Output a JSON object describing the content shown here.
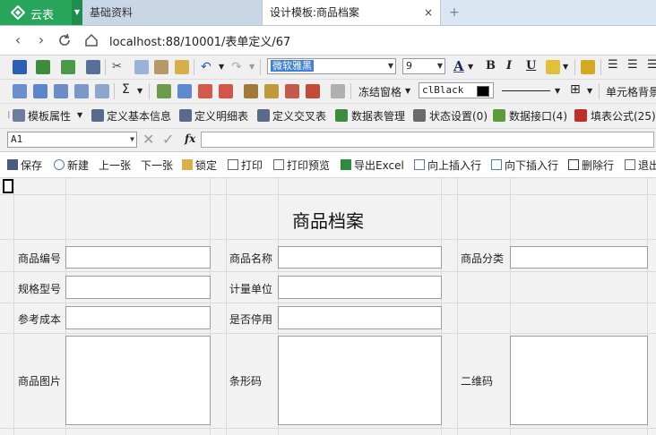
{
  "browser": {
    "app_name": "云表",
    "tabs": [
      {
        "label": "基础资料",
        "active": false
      },
      {
        "label": "设计模板:商品档案",
        "active": true
      }
    ],
    "close_glyph": "×",
    "new_tab_glyph": "+",
    "url": "localhost:88/10001/表单定义/67"
  },
  "format_toolbar": {
    "font_name": "微软雅黑",
    "font_size": "9",
    "text_color_glyph": "A",
    "bold": "B",
    "italic": "I",
    "underline": "U"
  },
  "table_toolbar": {
    "sum_glyph": "Σ",
    "freeze_label": "冻结窗格",
    "color_value": "clBlack",
    "cell_background_label": "单元格背景"
  },
  "template_toolbar": {
    "items": [
      {
        "label": "模板属性"
      },
      {
        "label": "定义基本信息"
      },
      {
        "label": "定义明细表"
      },
      {
        "label": "定义交叉表"
      },
      {
        "label": "数据表管理"
      },
      {
        "label": "状态设置(0)"
      },
      {
        "label": "数据接口(4)"
      },
      {
        "label": "填表公式(25)"
      }
    ]
  },
  "formula_bar": {
    "cell_ref": "A1",
    "fx": "fx",
    "formula": ""
  },
  "form_toolbar": {
    "items": [
      {
        "label": "保存"
      },
      {
        "label": "新建"
      },
      {
        "label": "上一张"
      },
      {
        "label": "下一张"
      },
      {
        "label": "锁定"
      },
      {
        "label": "打印"
      },
      {
        "label": "打印预览"
      },
      {
        "label": "导出Excel"
      },
      {
        "label": "向上插入行"
      },
      {
        "label": "向下插入行"
      },
      {
        "label": "删除行"
      },
      {
        "label": "退出"
      }
    ]
  },
  "sheet": {
    "title": "商品档案",
    "fields": {
      "code": "商品编号",
      "name": "商品名称",
      "category": "商品分类",
      "spec": "规格型号",
      "unit": "计量单位",
      "cost": "参考成本",
      "disabled": "是否停用",
      "image": "商品图片",
      "barcode": "条形码",
      "qrcode": "二维码"
    }
  },
  "colors": {
    "app_green": "#27a55b",
    "tab_bar": "#dbe6f3",
    "toolbar": "#f0f0f0",
    "sheet_bg": "#f2f2f2"
  }
}
